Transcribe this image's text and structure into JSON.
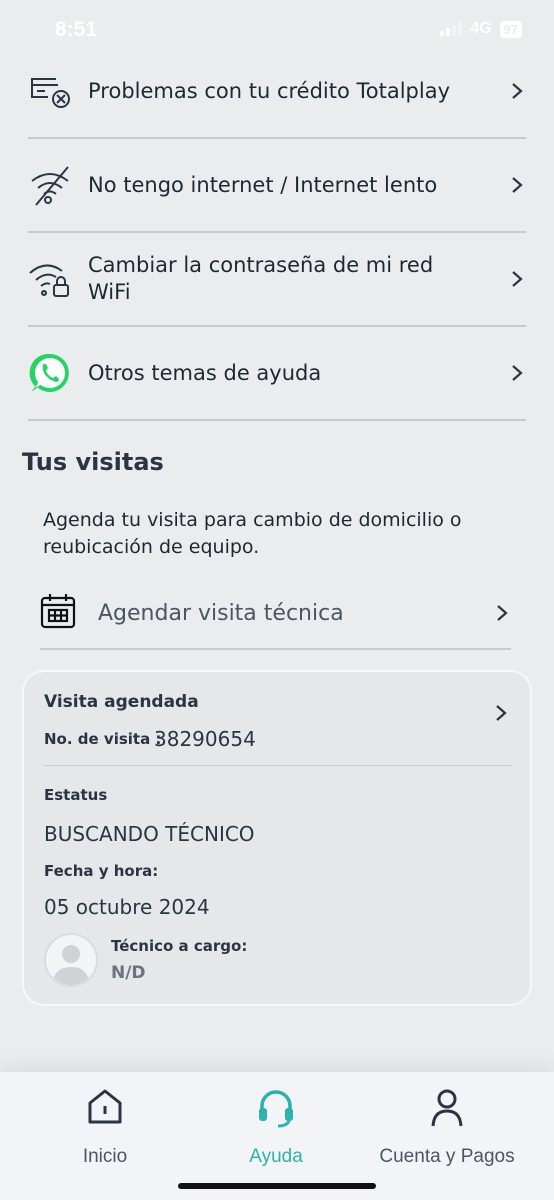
{
  "status_bar": {
    "time": "8:51",
    "network": "4G",
    "battery": "97"
  },
  "help_items": [
    {
      "label": "Problemas con tu crédito Totalplay",
      "icon": "card-cancel-icon"
    },
    {
      "label": "No tengo internet / Internet lento",
      "icon": "wifi-off-icon"
    },
    {
      "label": "Cambiar la contraseña de mi red WiFi",
      "icon": "wifi-lock-icon"
    },
    {
      "label": "Otros temas de ayuda",
      "icon": "whatsapp-icon"
    }
  ],
  "visits": {
    "title": "Tus visitas",
    "description": "Agenda tu visita para cambio de domicilio o reubicación de equipo.",
    "schedule_label": "Agendar visita técnica"
  },
  "visit_card": {
    "title": "Visita agendada",
    "number_label": "No. de visita :",
    "number_value": "38290654",
    "status_label": "Estatus",
    "status_value": "BUSCANDO TÉCNICO",
    "date_label": "Fecha y hora:",
    "date_value": "05 octubre 2024",
    "technician_label": "Técnico a cargo:",
    "technician_value": "N/D"
  },
  "tabs": [
    {
      "label": "Inicio",
      "icon": "home-icon",
      "active": false
    },
    {
      "label": "Ayuda",
      "icon": "headset-icon",
      "active": true
    },
    {
      "label": "Cuenta y Pagos",
      "icon": "user-icon",
      "active": false
    }
  ],
  "colors": {
    "accent": "#2ab3ad",
    "whatsapp": "#25d366",
    "background": "#ebecee"
  }
}
